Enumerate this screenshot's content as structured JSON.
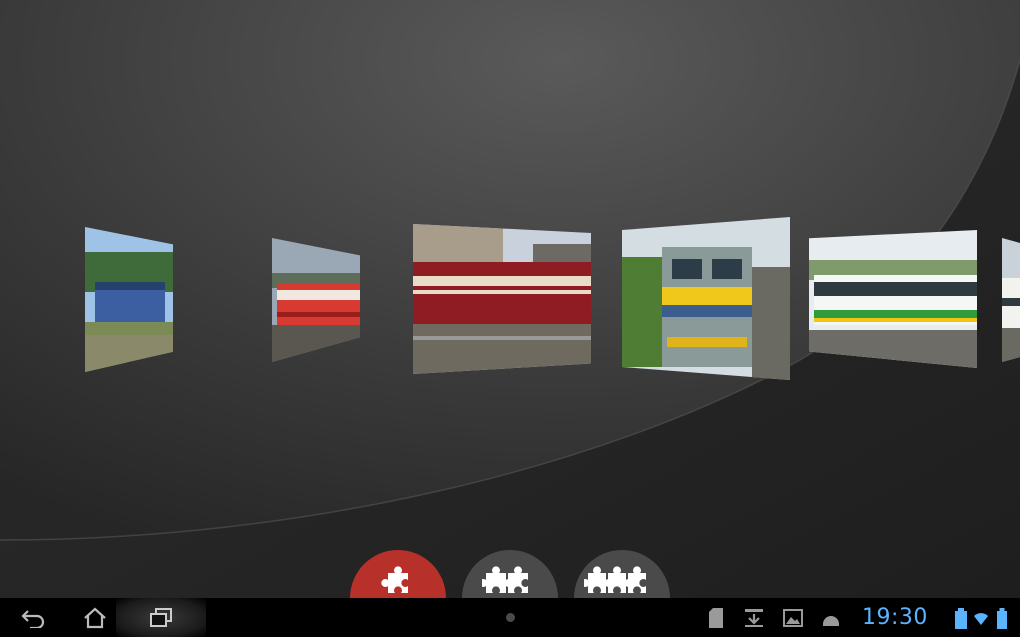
{
  "carousel": {
    "photos": [
      {
        "subject": "blue-locomotive-photo"
      },
      {
        "subject": "red-regional-train-photo"
      },
      {
        "subject": "red-cream-railcar-photo"
      },
      {
        "subject": "grey-yellow-electric-locomotive-photo"
      },
      {
        "subject": "white-green-dmu-photo"
      },
      {
        "subject": "partial-train-photo"
      }
    ]
  },
  "modes": [
    {
      "icon": "single-puzzle-piece-icon",
      "selected": true
    },
    {
      "icon": "two-puzzle-pieces-icon",
      "selected": false
    },
    {
      "icon": "three-puzzle-pieces-icon",
      "selected": false
    }
  ],
  "system_bar": {
    "clock": "19:30",
    "nav": [
      "back-icon",
      "home-icon",
      "recent-apps-icon"
    ],
    "notifications": [
      "sd-card-icon",
      "download-icon",
      "image-icon",
      "android-icon"
    ],
    "status": [
      "battery-dock-icon",
      "wifi-icon",
      "battery-icon"
    ]
  },
  "colors": {
    "accent": "#b8302a",
    "inactive_button": "#4a4a4a",
    "clock": "#5ab4ff"
  }
}
